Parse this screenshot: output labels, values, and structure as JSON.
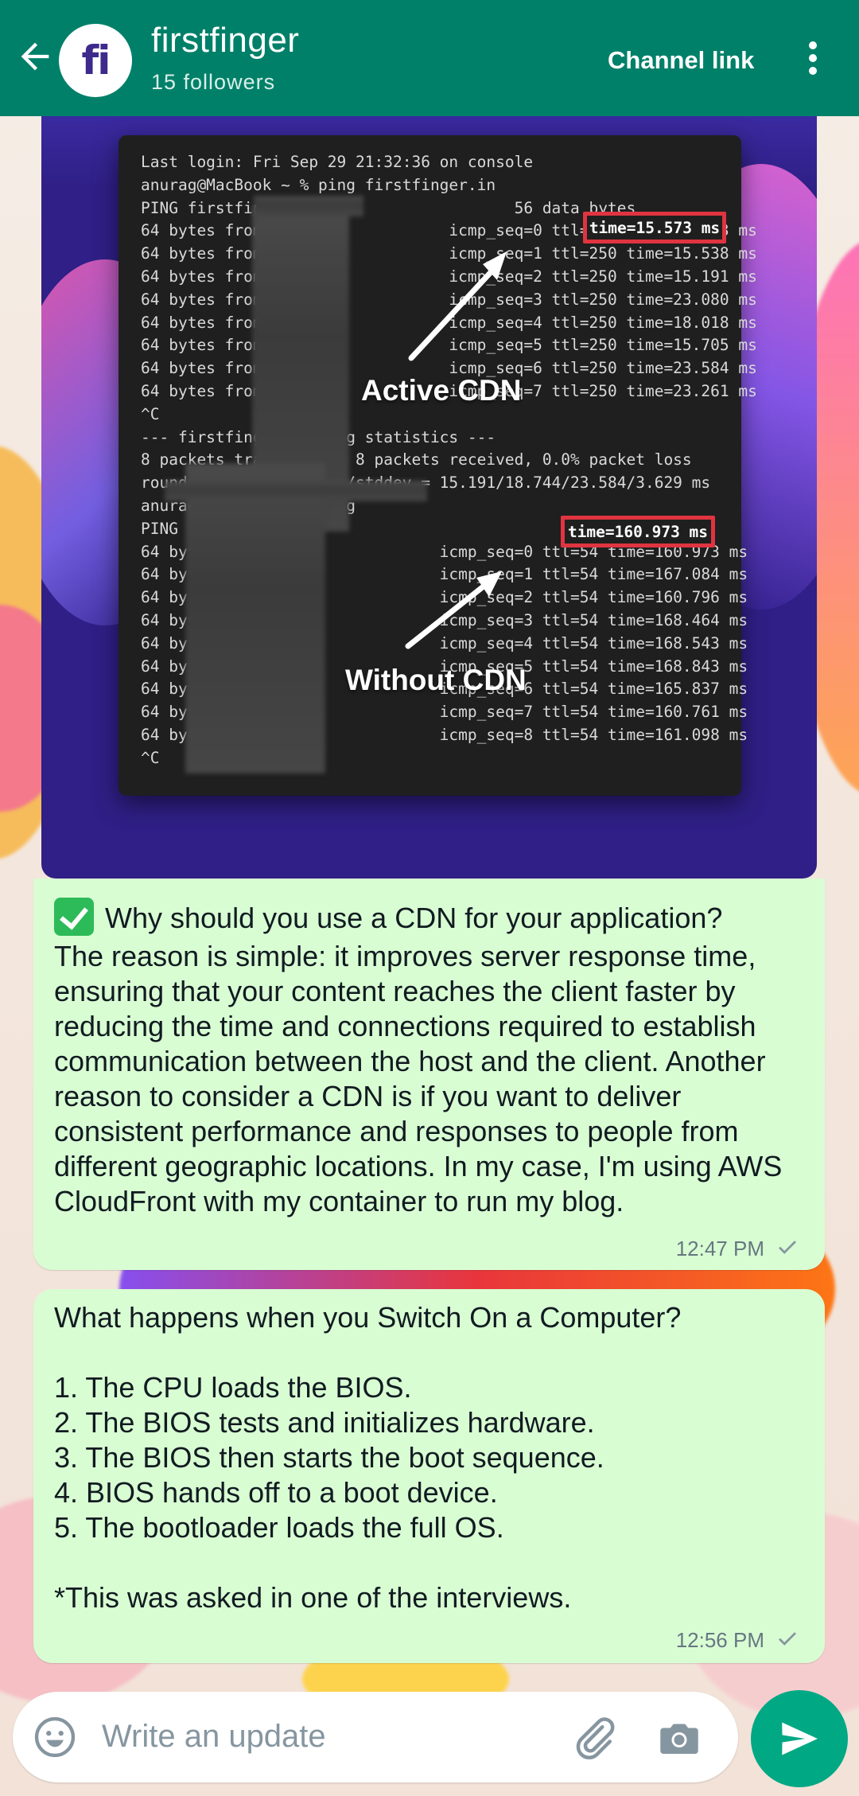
{
  "header": {
    "avatar_initials": "fi",
    "title": "firstfinger",
    "followers": "15 followers",
    "channel_link": "Channel link"
  },
  "image_message": {
    "terminal_lines": [
      "Last login: Fri Sep 29 21:32:36 on console",
      "anurag@MacBook ~ % ping firstfinger.in",
      "PING firstfinger.in                     56 data bytes",
      "64 bytes from                    icmp_seq=0 ttl=250 time=15.573 ms",
      "64 bytes from                    icmp_seq=1 ttl=250 time=15.538 ms",
      "64 bytes from                    icmp_seq=2 ttl=250 time=15.191 ms",
      "64 bytes from                    icmp_seq=3 ttl=250 time=23.080 ms",
      "64 bytes from                    icmp_seq=4 ttl=250 time=18.018 ms",
      "64 bytes from                    icmp_seq=5 ttl=250 time=15.705 ms",
      "64 bytes from                    icmp_seq=6 ttl=250 time=23.584 ms",
      "64 bytes from                    icmp_seq=7 ttl=250 time=23.261 ms",
      "^C",
      "--- firstfinger.in ping statistics ---",
      "8 packets transmitted, 8 packets received, 0.0% packet loss",
      "round-trip min/avg/max/stddev = 15.191/18.744/23.584/3.629 ms",
      "anurag@MacBook ~ % ping",
      "PING                                         56 data bytes",
      "64 bytes from                   icmp_seq=0 ttl=54 time=160.973 ms",
      "64 bytes from                   icmp_seq=1 ttl=54 time=167.084 ms",
      "64 bytes from                   icmp_seq=2 ttl=54 time=160.796 ms",
      "64 bytes from                   icmp_seq=3 ttl=54 time=168.464 ms",
      "64 bytes from                   icmp_seq=4 ttl=54 time=168.543 ms",
      "64 bytes from                   icmp_seq=5 ttl=54 time=168.843 ms",
      "64 bytes from                   icmp_seq=6 ttl=54 time=165.837 ms",
      "64 bytes from                   icmp_seq=7 ttl=54 time=160.761 ms",
      "64 bytes from                   icmp_seq=8 ttl=54 time=161.098 ms",
      "^C"
    ],
    "highlight_cdn": "time=15.573 ms",
    "highlight_no_cdn": "time=160.973 ms",
    "label_cdn": "Active CDN",
    "label_no_cdn": "Without CDN"
  },
  "messages": [
    {
      "heading": "Why should you use a CDN for your application?",
      "body": "The reason is simple: it improves server response time,\nensuring that your content reaches the client faster by\nreducing the time and connections required to establish\ncommunication between the host and the client. Another\nreason to consider a CDN is if you want to deliver\nconsistent performance and responses to people from\ndifferent geographic locations. In my case, I'm using AWS\nCloudFront with my container to run my blog.",
      "time": "12:47 PM"
    },
    {
      "body": "What happens when you Switch On a Computer?\n\n1. The CPU loads the BIOS.\n2. The BIOS tests and initializes hardware.\n3. The BIOS then starts the boot sequence.\n4. BIOS hands off to a boot device.\n5. The bootloader loads the full OS.\n\n*This was asked in one of the interviews.",
      "time": "12:56 PM"
    }
  ],
  "composer": {
    "placeholder": "Write an update"
  },
  "colors": {
    "header": "#008069",
    "bubble": "#d9fdd3",
    "send_button": "#00a884"
  }
}
